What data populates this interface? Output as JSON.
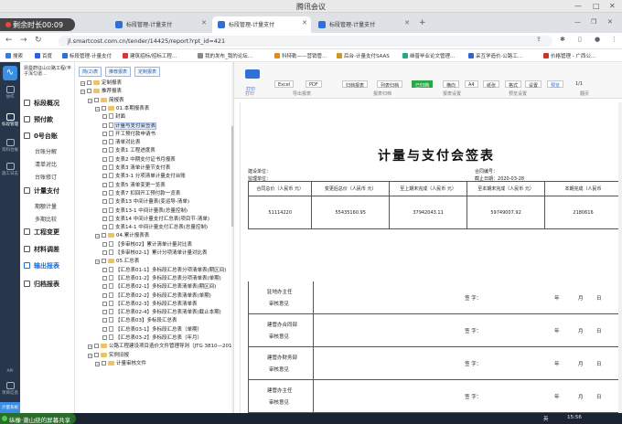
{
  "meeting": {
    "title": "腾讯会议",
    "timer": "剩余时长00:09"
  },
  "tabs": [
    {
      "label": "标段管理-计量支付"
    },
    {
      "label": "标段管理-计量支付"
    },
    {
      "label": "标段管理-计量支付"
    }
  ],
  "browser": {
    "url": "jl.smartcost.com.cn/tender/14425/report?rpt_id=421"
  },
  "bookmarks": [
    "搜索",
    "百度",
    "标段管理-计量支付",
    "建筑招标/招标工程…",
    "我的发布_我的论坛…",
    "科特勒——营销管…",
    "后台-计量支付SAAS",
    "继普毕业论文管理…",
    "采互学造价·公路工…",
    "价格管理 - 广西公…"
  ],
  "app_nav": {
    "items": [
      "协作",
      "标段管理",
      "资料台账",
      "施工日志",
      "API",
      "项目信息",
      "计量系统"
    ]
  },
  "project": {
    "name": "昆曼蔚征山公路工程(丰子浑匀道…"
  },
  "menu": {
    "items": [
      {
        "label": "标段概况"
      },
      {
        "label": "预付款"
      },
      {
        "label": "0号台账",
        "subs": [
          "台账分解",
          "清单对比",
          "台账修订"
        ]
      },
      {
        "label": "计量支付",
        "subs": [
          "期额计量",
          "多期比较"
        ]
      },
      {
        "label": "工程变更"
      },
      {
        "label": "材料调差"
      },
      {
        "label": "输出报表"
      },
      {
        "label": "归档报表"
      }
    ]
  },
  "tree": {
    "toolbar": [
      "简(2)表",
      "推荐报表",
      "定制报表"
    ],
    "nodes": [
      {
        "label": "定制报表",
        "type": "folder",
        "level": 0
      },
      {
        "label": "推荐报表",
        "type": "folder",
        "level": 0
      },
      {
        "label": "简报表",
        "type": "folder",
        "level": 1
      },
      {
        "label": "01.本期报表表",
        "type": "folder",
        "level": 2
      },
      {
        "label": "封面",
        "type": "page",
        "level": 3
      },
      {
        "label": "计量与支付会签表",
        "type": "page",
        "level": 3,
        "selected": true
      },
      {
        "label": "开工预付款申请书",
        "type": "page",
        "level": 3
      },
      {
        "label": "清单对比表",
        "type": "page",
        "level": 3
      },
      {
        "label": "支表1 工程进度表",
        "type": "page",
        "level": 3
      },
      {
        "label": "支表2 中期支付证书月报表",
        "type": "page",
        "level": 3
      },
      {
        "label": "支表3 清单计量节支付表",
        "type": "page",
        "level": 3
      },
      {
        "label": "支表3-1 分项清单计量支付台账",
        "type": "page",
        "level": 3
      },
      {
        "label": "支表5 清单变更一览表",
        "type": "page",
        "level": 3
      },
      {
        "label": "支表7 扣回开工预付款一览表",
        "type": "page",
        "level": 3
      },
      {
        "label": "支表13 中间计量表(变运导-清单)",
        "type": "page",
        "level": 3
      },
      {
        "label": "支表13-1 中间计量表(总量控制)",
        "type": "page",
        "level": 3
      },
      {
        "label": "支表14 中间计量支付汇总表(项目节-清单)",
        "type": "page",
        "level": 3
      },
      {
        "label": "支表14-1 中间计量支付汇总表(总量控制)",
        "type": "page",
        "level": 3
      },
      {
        "label": "04.累计报表表",
        "type": "folder",
        "level": 2
      },
      {
        "label": "【多审核02】累计清单计量对比表",
        "type": "page",
        "level": 3
      },
      {
        "label": "【多审核02-1】累计分项清单计量对比表",
        "type": "page",
        "level": 3
      },
      {
        "label": "05.汇总表",
        "type": "folder",
        "level": 2
      },
      {
        "label": "【汇总表01-1】多标段汇总表分项清单表(期区间)",
        "type": "page",
        "level": 3
      },
      {
        "label": "【汇总表01-2】多标段汇总表分项清单表(单期)",
        "type": "page",
        "level": 3
      },
      {
        "label": "【汇总表02-1】多标段汇总表清单表(期区间)",
        "type": "page",
        "level": 3
      },
      {
        "label": "【汇总表02-2】多标段汇总表清单表(单期)",
        "type": "page",
        "level": 3
      },
      {
        "label": "【汇总表02-3】多标段汇总表清单表",
        "type": "page",
        "level": 3
      },
      {
        "label": "【汇总表02-4】多标段汇总表清单表(截止本期)",
        "type": "page",
        "level": 3
      },
      {
        "label": "【汇总表03】多标段汇总表",
        "type": "page",
        "level": 3
      },
      {
        "label": "【汇总表03-1】多标段汇总表（单期）",
        "type": "page",
        "level": 3
      },
      {
        "label": "【汇总表03-2】多标段汇总表（年月）",
        "type": "page",
        "level": 3
      },
      {
        "label": "公路工程建设项目造价文件管理导则（JTG 3810—2017）",
        "type": "folder",
        "level": 1
      },
      {
        "label": "实例旧报",
        "type": "folder",
        "level": 1
      },
      {
        "label": "计量审核文件",
        "type": "folder",
        "level": 2
      }
    ]
  },
  "ribbon": {
    "buttons": [
      "打印",
      "Excel",
      "PDF",
      "归档报表",
      "列表归档",
      "已归档",
      "横向",
      "A4",
      "纸张",
      "格式",
      "设置",
      "预览",
      "1/1"
    ],
    "groups": [
      "打印",
      "导出报表",
      "报表归档",
      "报表设置",
      "预览设置",
      "翻页"
    ]
  },
  "report": {
    "title": "计量与支付会签表",
    "unit_label": "建设单位：",
    "supervise_label": "监理单位：",
    "contract_label": "合同编号：",
    "date_label": "截止日期：",
    "date": "2020-03-28",
    "columns": [
      "合同总价（人民币 元）",
      "变更后总价（人民币 元）",
      "至上期末完成（人民币 元）",
      "至本期末完成（人民币 元）",
      "本期完成（人民币"
    ],
    "values": [
      "51114220",
      "55435160.95",
      "37942043.11",
      "59749007.92",
      "2180616"
    ],
    "sign_blocks": [
      {
        "lines": [
          "驻地办主任",
          "审核意见"
        ]
      },
      {
        "lines": [
          "建管办合同部",
          "审核意见"
        ]
      },
      {
        "lines": [
          "建管办财务部",
          "审核意见"
        ]
      },
      {
        "lines": [
          "建管办主任",
          "审核意见"
        ]
      }
    ],
    "sign_text": "签 字：",
    "date_parts": [
      "年",
      "月",
      "日"
    ]
  },
  "taskbar": {
    "share_text": "纵橡·萧山绕的屏幕共享",
    "time": "15:56"
  }
}
